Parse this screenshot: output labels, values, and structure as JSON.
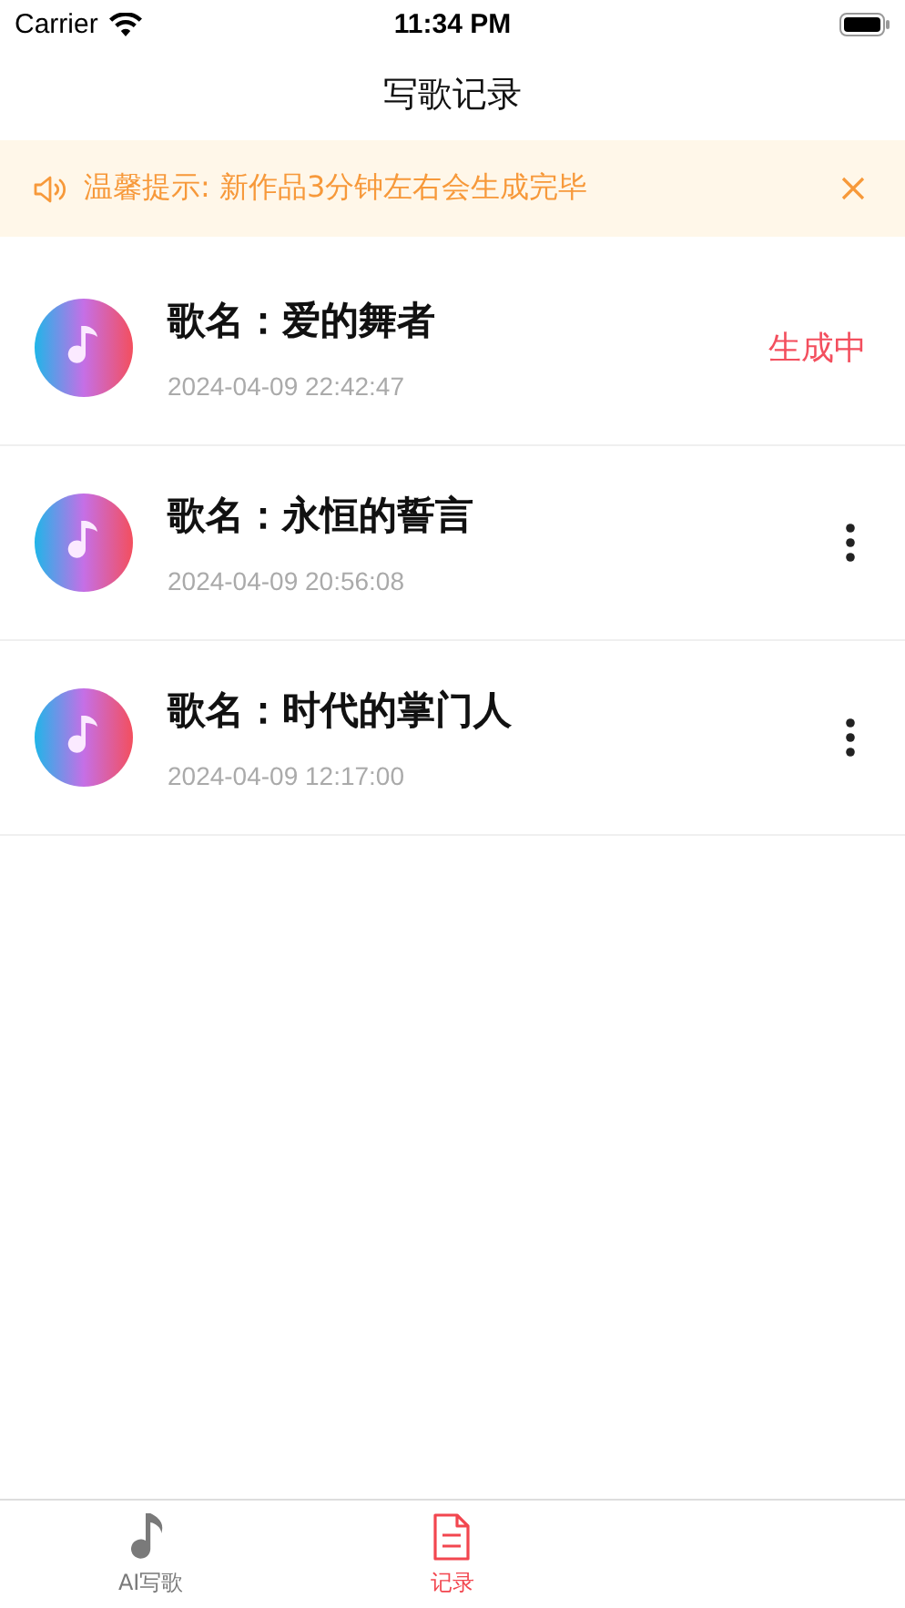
{
  "status_bar": {
    "carrier": "Carrier",
    "time": "11:34 PM"
  },
  "nav": {
    "title": "写歌记录"
  },
  "notice": {
    "text": "温馨提示: 新作品3分钟左右会生成完毕"
  },
  "records": [
    {
      "title": "歌名：爱的舞者",
      "time": "2024-04-09 22:42:47",
      "kind": "status",
      "status": "生成中"
    },
    {
      "title": "歌名：永恒的誓言",
      "time": "2024-04-09 20:56:08",
      "kind": "menu"
    },
    {
      "title": "歌名：时代的掌门人",
      "time": "2024-04-09 12:17:00",
      "kind": "menu"
    }
  ],
  "tabs": [
    {
      "label": "AI写歌",
      "kind": "note",
      "selected": false
    },
    {
      "label": "记录",
      "kind": "doc",
      "selected": true
    }
  ]
}
